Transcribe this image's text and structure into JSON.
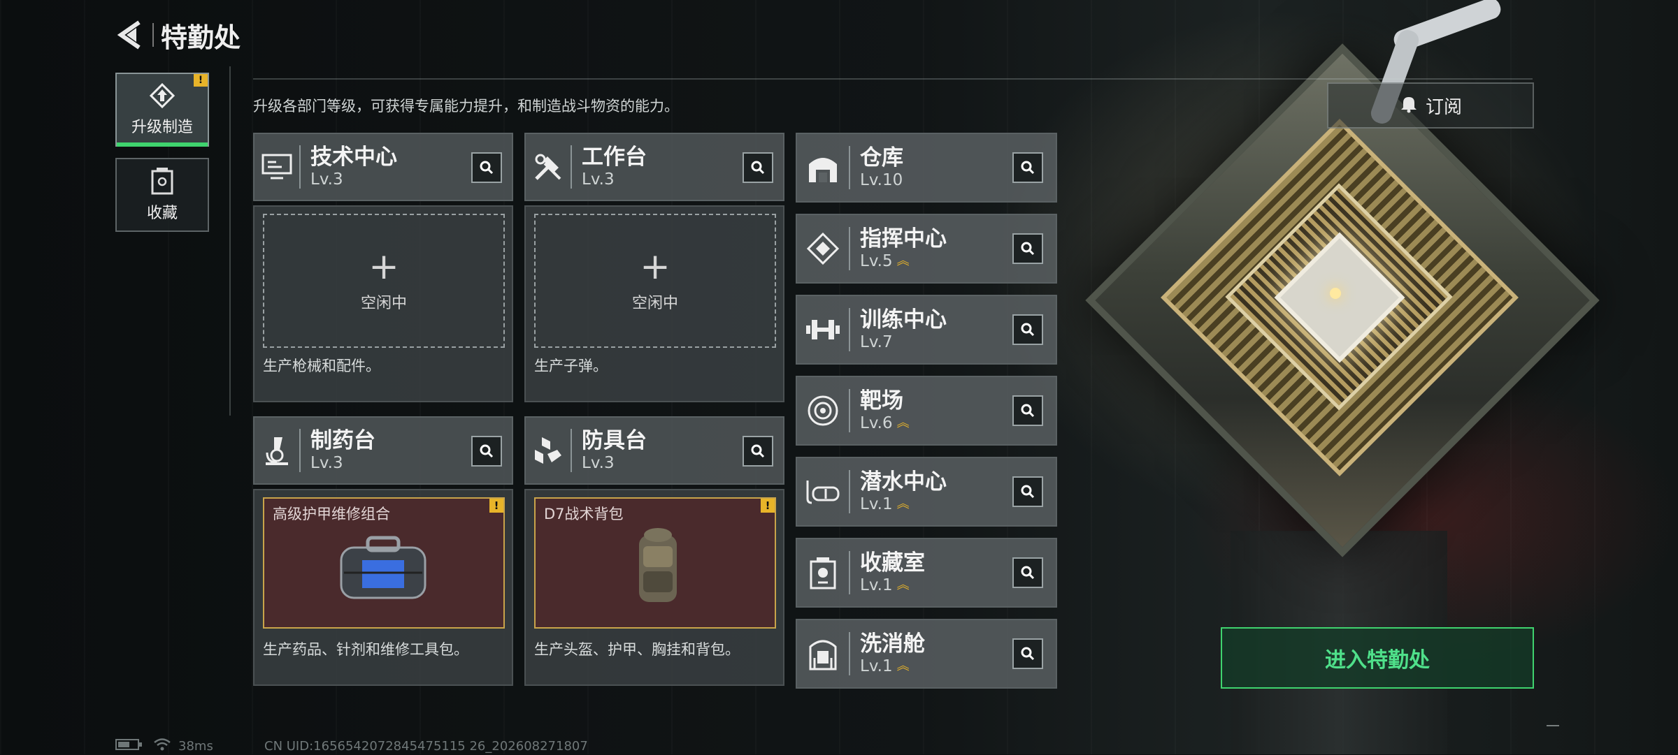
{
  "header": {
    "title": "特勤处"
  },
  "tabs": [
    {
      "label": "升级制造",
      "badge": "!",
      "active": true
    },
    {
      "label": "收藏"
    }
  ],
  "subtitle": "升级各部门等级，可获得专属能力提升，和制造战斗物资的能力。",
  "subscribe_label": "订阅",
  "cards": [
    {
      "name": "技术中心",
      "level": "Lv.3",
      "icon": "monitor-icon",
      "slot_label": "空闲中",
      "desc": "生产枪械和配件。"
    },
    {
      "name": "工作台",
      "level": "Lv.3",
      "icon": "tools-icon",
      "slot_label": "空闲中",
      "desc": "生产子弹。"
    },
    {
      "name": "制药台",
      "level": "Lv.3",
      "icon": "microscope-icon",
      "item": "高级护甲维修组合",
      "badge": "!",
      "desc": "生产药品、针剂和维修工具包。"
    },
    {
      "name": "防具台",
      "level": "Lv.3",
      "icon": "armor-blocks-icon",
      "item": "D7战术背包",
      "badge": "!",
      "desc": "生产头盔、护甲、胸挂和背包。"
    }
  ],
  "facilities": [
    {
      "name": "仓库",
      "level": "Lv.10",
      "icon": "warehouse-icon",
      "upgradable": false
    },
    {
      "name": "指挥中心",
      "level": "Lv.5",
      "icon": "command-diamond-icon",
      "upgradable": true
    },
    {
      "name": "训练中心",
      "level": "Lv.7",
      "icon": "dumbbell-icon",
      "upgradable": false
    },
    {
      "name": "靶场",
      "level": "Lv.6",
      "icon": "target-icon",
      "upgradable": true
    },
    {
      "name": "潜水中心",
      "level": "Lv.1",
      "icon": "diving-mask-icon",
      "upgradable": true
    },
    {
      "name": "收藏室",
      "level": "Lv.1",
      "icon": "trophy-box-icon",
      "upgradable": true
    },
    {
      "name": "洗消舱",
      "level": "Lv.1",
      "icon": "decon-pod-icon",
      "upgradable": true
    }
  ],
  "enter_label": "进入特勤处",
  "status": {
    "ping": "38ms",
    "uid": "CN UID:1656542072845475115 26_202608271807"
  },
  "colors": {
    "accent": "#3fd36e",
    "badge": "#e8b429",
    "item_border": "#c9a44a"
  }
}
